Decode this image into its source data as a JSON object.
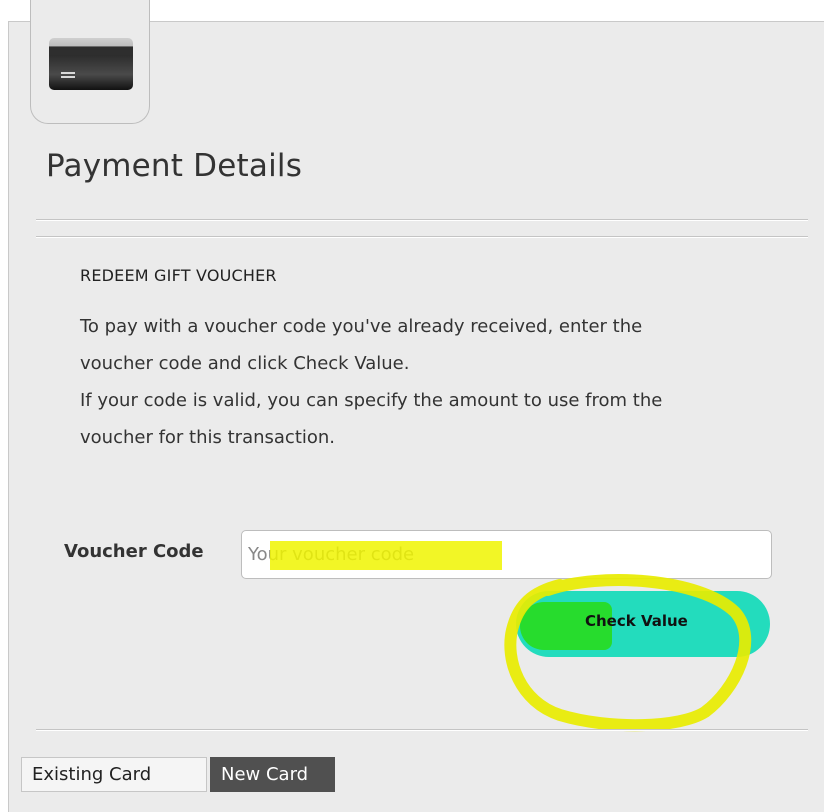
{
  "header": {
    "icon": "credit-card-icon",
    "title": "Payment Details"
  },
  "voucher_section": {
    "heading": "REDEEM GIFT VOUCHER",
    "paragraph_1a": "To pay with a voucher code you've already received, enter the",
    "paragraph_1b": "voucher code and click Check Value.",
    "paragraph_2a": "If your code is valid, you can specify the amount to use from the",
    "paragraph_2b": "voucher for this transaction."
  },
  "voucher_form": {
    "label": "Voucher Code",
    "placeholder": "Your voucher code",
    "value": "",
    "button_label": "Check Value"
  },
  "tabs": [
    {
      "label": "Existing Card",
      "active": true
    },
    {
      "label": "New Card",
      "active": false
    }
  ],
  "colors": {
    "button": "#23dcbd",
    "highlight_yellow": "#f0f500",
    "highlight_green": "#28dc14",
    "panel_bg": "#ebebeb",
    "tab_inactive": "#505050"
  }
}
